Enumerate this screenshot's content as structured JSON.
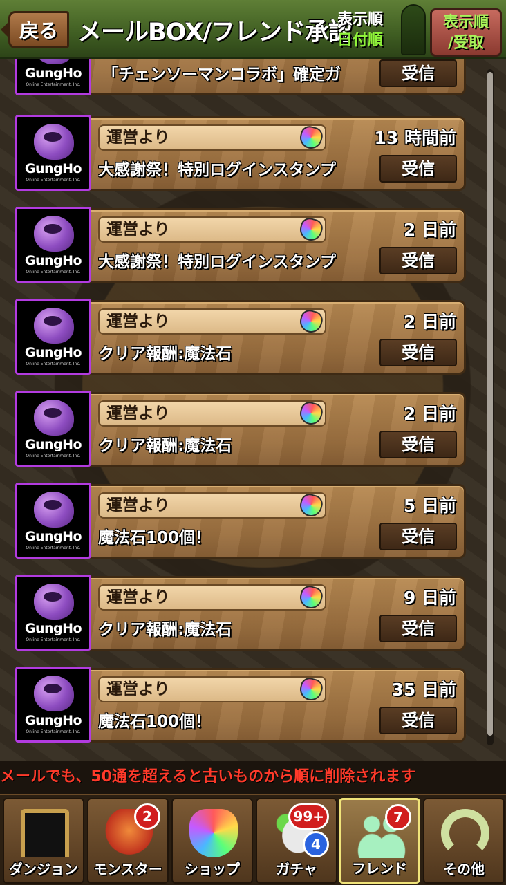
{
  "header": {
    "back_label": "戻る",
    "title": "メールBOX/フレンド承認",
    "sort_line1": "表示順",
    "sort_line2": "日付順",
    "sort_button_line1": "表示順",
    "sort_button_line2": "/受取"
  },
  "mail": {
    "partial": {
      "subject": "「チェンソーマンコラボ」確定ガ",
      "receive_label": "受信"
    },
    "items": [
      {
        "sender": "運営より",
        "time": "13 時間前",
        "subject": "大感謝祭！特別ログインスタンプ",
        "receive_label": "受信"
      },
      {
        "sender": "運営より",
        "time": "2 日前",
        "subject": "大感謝祭！特別ログインスタンプ",
        "receive_label": "受信"
      },
      {
        "sender": "運営より",
        "time": "2 日前",
        "subject": "クリア報酬:魔法石",
        "receive_label": "受信"
      },
      {
        "sender": "運営より",
        "time": "2 日前",
        "subject": "クリア報酬:魔法石",
        "receive_label": "受信"
      },
      {
        "sender": "運営より",
        "time": "5 日前",
        "subject": "魔法石100個！",
        "receive_label": "受信"
      },
      {
        "sender": "運営より",
        "time": "9 日前",
        "subject": "クリア報酬:魔法石",
        "receive_label": "受信"
      },
      {
        "sender": "運営より",
        "time": "35 日前",
        "subject": "魔法石100個！",
        "receive_label": "受信"
      }
    ],
    "avatar_brand": "GungHo",
    "avatar_sub": "Online Entertainment, Inc."
  },
  "warning": "メールでも、50通を超えると古いものから順に削除されます",
  "nav": {
    "dungeon": {
      "label": "ダンジョン"
    },
    "monster": {
      "label": "モンスター",
      "badge": "2"
    },
    "shop": {
      "label": "ショップ"
    },
    "gacha": {
      "label": "ガチャ",
      "badge": "99+",
      "badge2": "4"
    },
    "friend": {
      "label": "フレンド",
      "badge": "7"
    },
    "other": {
      "label": "その他"
    }
  },
  "colors": {
    "header_green": "#4a6a28",
    "avatar_border": "#b23be0",
    "warning_red": "#ff3a2a",
    "badge_red": "#d11e1e",
    "badge_blue": "#2a63e0"
  }
}
